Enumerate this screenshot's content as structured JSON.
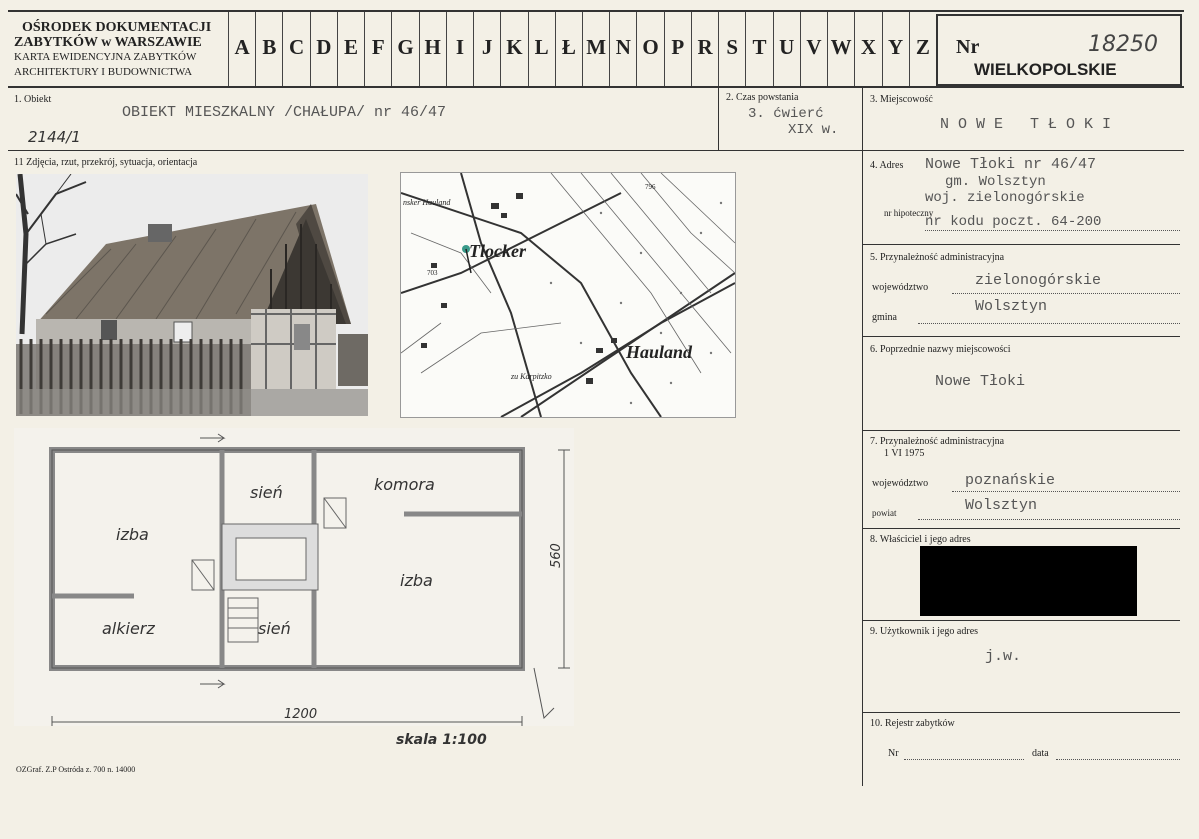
{
  "header": {
    "org_line1": "OŚRODEK DOKUMENTACJI",
    "org_line2": "ZABYTKÓW w WARSZAWIE",
    "org_line3": "KARTA EWIDENCYJNA ZABYTKÓW",
    "org_line4": "ARCHITEKTURY I BUDOWNICTWA",
    "alphabet": [
      "A",
      "B",
      "C",
      "D",
      "E",
      "F",
      "G",
      "H",
      "I",
      "J",
      "K",
      "L",
      "Ł",
      "M",
      "N",
      "O",
      "P",
      "R",
      "S",
      "T",
      "U",
      "V",
      "W",
      "X",
      "Y",
      "Z"
    ],
    "nr_label": "Nr",
    "nr_value": "18250",
    "voivodeship": "WIELKOPOLSKIE"
  },
  "fields": {
    "obiekt_label": "1. Obiekt",
    "obiekt_value": "OBIEKT MIESZKALNY /CHAŁUPA/ nr 46/47",
    "obiekt_hand": "2144/1",
    "czas_label": "2. Czas powstania",
    "czas_value1": "3. ćwierć",
    "czas_value2": "XIX w.",
    "miejscowosc_label": "3. Miejscowość",
    "miejscowosc_value": "N O W E   T Ł O K I",
    "zdjecia_label": "11 Zdjęcia, rzut, przekrój, sytuacja, orientacja",
    "adres_label": "4. Adres",
    "adres_line1": "Nowe Tłoki nr 46/47",
    "adres_line2": "gm. Wolsztyn",
    "adres_line3": "woj. zielonogórskie",
    "hipoteczny_label": "nr hipoteczny",
    "adres_line4": "nr kodu poczt. 64-200",
    "przyn_label": "5. Przynależność administracyjna",
    "woj_label": "województwo",
    "woj_value": "zielonogórskie",
    "gmina_label": "gmina",
    "gmina_value": "Wolsztyn",
    "poprz_label": "6. Poprzednie nazwy miejscowości",
    "poprz_value": "Nowe Tłoki",
    "przyn75_label": "7. Przynależność administracyjna",
    "przyn75_date": "1 VI 1975",
    "woj75_label": "województwo",
    "woj75_value": "poznańskie",
    "powiat_label": "powiat",
    "powiat_value": "Wolsztyn",
    "wlasciciel_label": "8. Właściciel i jego adres",
    "uzytkownik_label": "9. Użytkownik i jego adres",
    "uzytkownik_value": "j.w.",
    "rejestr_label": "10. Rejestr zabytków",
    "rejestr_nr_label": "Nr",
    "rejestr_data_label": "data",
    "footer_print": "OZGraf. Z.P  Ostróda z. 700 n. 14000"
  },
  "map": {
    "label_tlocker": "Tlocker",
    "label_hauland": "Hauland",
    "label_karpitzko": "zu Karpitzko",
    "label_hauland_small": "nsker Hauland",
    "label_703": "703",
    "label_796": "796"
  },
  "plan": {
    "room_sien_top": "sień",
    "room_komora": "komora",
    "room_izba_left": "izba",
    "room_izba_right": "izba",
    "room_alkierz": "alkierz",
    "room_sien_bottom": "sień",
    "dim_width": "1200",
    "dim_height": "560",
    "scale": "skala 1:100"
  }
}
